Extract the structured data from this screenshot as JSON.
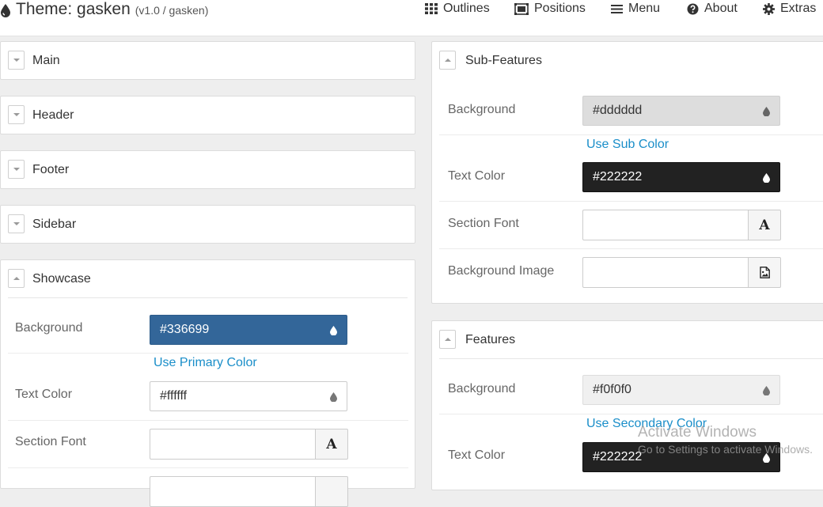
{
  "header": {
    "title": "Theme: gasken",
    "version": "(v1.0 / gasken)",
    "nav": [
      {
        "label": "Outlines",
        "icon": "grid-icon"
      },
      {
        "label": "Positions",
        "icon": "positions-icon"
      },
      {
        "label": "Menu",
        "icon": "menu-icon"
      },
      {
        "label": "About",
        "icon": "question-circle-icon"
      },
      {
        "label": "Extras",
        "icon": "gear-icon"
      }
    ]
  },
  "left": {
    "collapsed": [
      "Main",
      "Header",
      "Footer",
      "Sidebar"
    ],
    "showcase": {
      "title": "Showcase",
      "background_label": "Background",
      "background_value": "#336699",
      "background_link": "Use Primary Color",
      "text_color_label": "Text Color",
      "text_color_value": "#ffffff",
      "section_font_label": "Section Font"
    }
  },
  "right": {
    "subfeatures": {
      "title": "Sub-Features",
      "background_label": "Background",
      "background_value": "#dddddd",
      "background_link": "Use Sub Color",
      "text_color_label": "Text Color",
      "text_color_value": "#222222",
      "section_font_label": "Section Font",
      "background_image_label": "Background Image"
    },
    "features": {
      "title": "Features",
      "background_label": "Background",
      "background_value": "#f0f0f0",
      "background_link": "Use Secondary Color",
      "text_color_label": "Text Color",
      "text_color_value": "#222222"
    }
  },
  "watermark": {
    "line1": "Activate Windows",
    "line2": "Go to Settings to activate Windows."
  },
  "colors": {
    "link": "#1a8ec9",
    "showcase_bg": "#336699",
    "dark_field": "#222222",
    "light_field": "#dddddd",
    "features_field": "#f0f0f0"
  }
}
